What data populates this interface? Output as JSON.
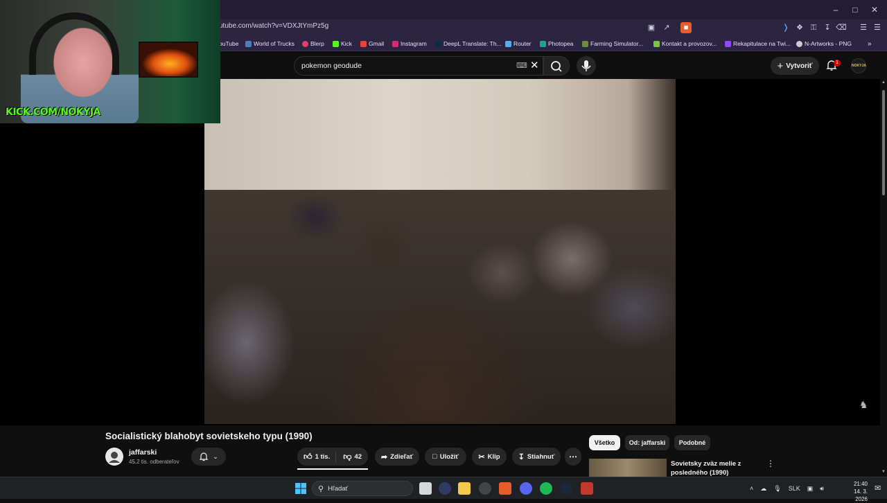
{
  "browser": {
    "url": "utube.com/watch?v=VDXJtYmPz5g",
    "bookmarks": [
      {
        "label": "ouTube",
        "color": "#ff0000"
      },
      {
        "label": "World of Trucks",
        "color": "#4a7fbf"
      },
      {
        "label": "Blerp",
        "color": "#e83a6f"
      },
      {
        "label": "Kick",
        "color": "#53fc18"
      },
      {
        "label": "Gmail",
        "color": "#ea4335"
      },
      {
        "label": "Instagram",
        "color": "#d62976"
      },
      {
        "label": "DeepL Translate: Th...",
        "color": "#0f2b46"
      },
      {
        "label": "Router",
        "color": "#4fb3e8"
      },
      {
        "label": "Photopea",
        "color": "#18a497"
      },
      {
        "label": "Farming Simulator...",
        "color": "#6b8c3a"
      },
      {
        "label": "Kontakt a provozov...",
        "color": "#7cc243"
      },
      {
        "label": "Rekapitulace na Twi...",
        "color": "#9146ff"
      },
      {
        "label": "N-Artworks - PNG",
        "color": "#cccccc"
      }
    ]
  },
  "header": {
    "search_value": "pokemon geodude",
    "create_label": "Vytvoriť",
    "notification_count": "1",
    "avatar_text": "NOKYJA"
  },
  "webcam": {
    "overlay_text": "KICK.COM/NOKYJA"
  },
  "video": {
    "title": "Socialistický blahobyt sovietskeho typu (1990)",
    "channel": "jaffarski",
    "subscribers": "45,2 tis. odberateľov",
    "likes": "1 tis.",
    "dislikes": "42",
    "share_label": "Zdieľať",
    "save_label": "Uložiť",
    "clip_label": "Klip",
    "download_label": "Stiahnuť"
  },
  "sidebar": {
    "chips": [
      "Všetko",
      "Od: jaffarski",
      "Podobné"
    ],
    "related": [
      {
        "title": "Sovietsky zväz melie z posledného (1990)"
      }
    ]
  },
  "taskbar": {
    "search_placeholder": "Hľadať",
    "language": "SLK",
    "time": "21:40",
    "date": "14. 3. 2026"
  },
  "colors": {
    "accent": "#ffffff",
    "kick_green": "#53fc18",
    "notification_red": "#cc0000"
  }
}
